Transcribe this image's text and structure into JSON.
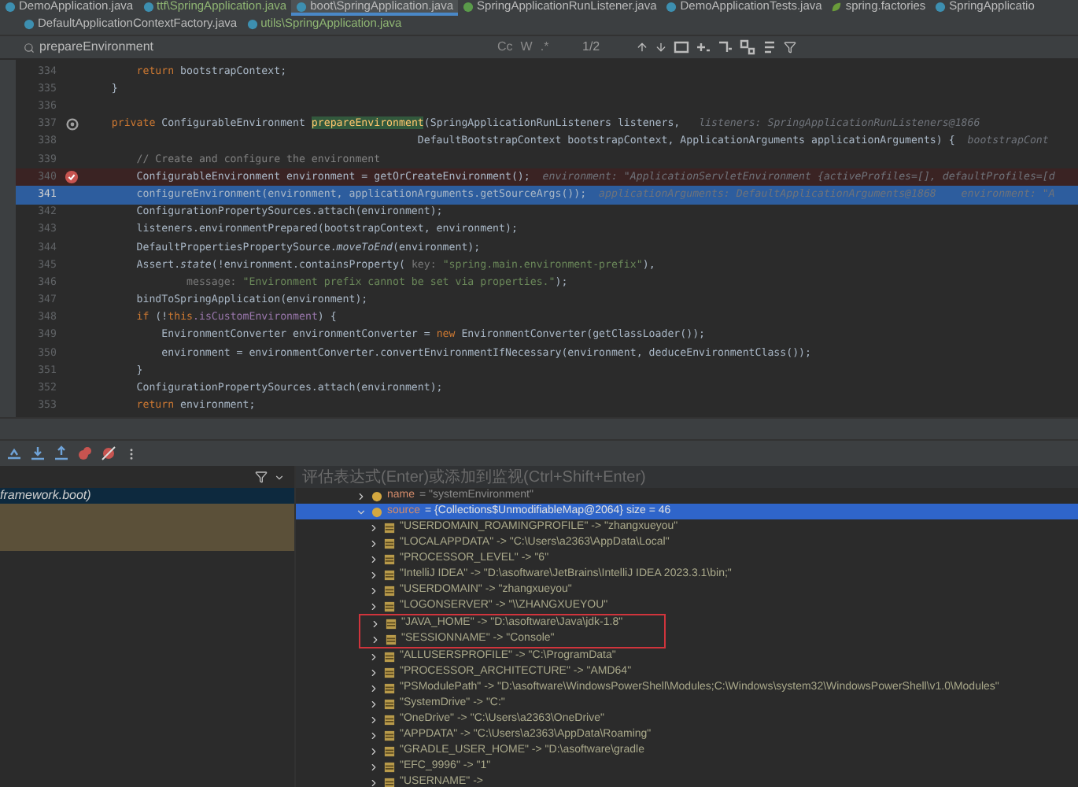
{
  "editor_tabs": [
    {
      "label": "DemoApplication.java",
      "kind": "java",
      "selected": false,
      "color": "#bbbbbb"
    },
    {
      "label": "ttf\\SpringApplication.java",
      "kind": "java",
      "selected": false,
      "color": "#8fb573"
    },
    {
      "label": "boot\\SpringApplication.java",
      "kind": "java",
      "selected": true,
      "color": "#bbbbbb"
    },
    {
      "label": "SpringApplicationRunListener.java",
      "kind": "interface",
      "selected": false,
      "color": "#bbbbbb"
    },
    {
      "label": "DemoApplicationTests.java",
      "kind": "java",
      "selected": false,
      "color": "#bbbbbb"
    },
    {
      "label": "spring.factories",
      "kind": "factories",
      "selected": false,
      "color": "#bbbbbb"
    },
    {
      "label": "SpringApplicatio",
      "kind": "java",
      "selected": false,
      "color": "#bbbbbb"
    }
  ],
  "editor_tabs_row_2": [
    {
      "label": "DefaultApplicationContextFactory.java",
      "kind": "java",
      "selected": false,
      "color": "#bbbbbb"
    },
    {
      "label": "utils\\SpringApplication.java",
      "kind": "java",
      "selected": false,
      "color": "#8fb573"
    }
  ],
  "find_bar": {
    "value": "prepareEnvironment",
    "options": [
      "Cc",
      "W",
      ".*"
    ],
    "match_count": "1/2"
  },
  "code_lines": [
    {
      "number": "334",
      "breakpoint": false,
      "override": false,
      "current": false,
      "tokens": [
        {
          "kind": "keyword",
          "text": "        return"
        },
        {
          "kind": "plain",
          "text": " bootstrapContext;"
        }
      ]
    },
    {
      "number": "335",
      "breakpoint": false,
      "override": false,
      "current": false,
      "tokens": [
        {
          "kind": "plain",
          "text": "    }"
        }
      ]
    },
    {
      "number": "336",
      "breakpoint": false,
      "override": false,
      "current": false
    },
    {
      "number": "337",
      "breakpoint": false,
      "override": true,
      "current": false,
      "tokens": [
        {
          "kind": "keyword",
          "text": "    private"
        },
        {
          "kind": "plain",
          "text": " ConfigurableEnvironment "
        },
        {
          "kind": "match",
          "text": "prepareEnvironment"
        },
        {
          "kind": "plain",
          "text": "(SpringApplicationRunListeners listeners,"
        },
        {
          "kind": "hint",
          "text": "   listeners: SpringApplicationRunListeners@1866"
        }
      ]
    },
    {
      "number": "338",
      "breakpoint": false,
      "override": false,
      "current": false,
      "tokens": [
        {
          "kind": "plain",
          "text": "                                                     DefaultBootstrapContext bootstrapContext, ApplicationArguments applicationArguments) {"
        },
        {
          "kind": "hint",
          "text": "  bootstrapCont"
        }
      ]
    },
    {
      "number": "339",
      "breakpoint": false,
      "override": false,
      "current": false,
      "tokens": [
        {
          "kind": "comment",
          "text": "        // Create and configure the environment"
        }
      ]
    },
    {
      "number": "340",
      "breakpoint": true,
      "override": false,
      "current": false,
      "tokens": [
        {
          "kind": "plain",
          "text": "        ConfigurableEnvironment environment = getOrCreateEnvironment();"
        },
        {
          "kind": "hint",
          "text": "  environment: \"ApplicationServletEnvironment {activeProfiles=[], defaultProfiles=[d"
        }
      ]
    },
    {
      "number": "341",
      "breakpoint": false,
      "override": false,
      "current": true,
      "tokens": [
        {
          "kind": "plain",
          "text": "        configureEnvironment(environment, applicationArguments.getSourceArgs());"
        },
        {
          "kind": "hint",
          "text": "  applicationArguments: DefaultApplicationArguments@1868    environment: \"A"
        }
      ]
    },
    {
      "number": "342",
      "breakpoint": false,
      "override": false,
      "current": false,
      "tokens": [
        {
          "kind": "plain",
          "text": "        ConfigurationPropertySources.attach(environment);"
        }
      ]
    },
    {
      "number": "343",
      "breakpoint": false,
      "override": false,
      "current": false,
      "tokens": [
        {
          "kind": "plain",
          "text": "        listeners.environmentPrepared(bootstrapContext, environment);"
        }
      ]
    },
    {
      "number": "344",
      "breakpoint": false,
      "override": false,
      "current": false,
      "tokens": [
        {
          "kind": "plain",
          "text": "        DefaultPropertiesPropertySource."
        },
        {
          "kind": "static",
          "text": "moveToEnd"
        },
        {
          "kind": "plain",
          "text": "(environment);"
        }
      ]
    },
    {
      "number": "345",
      "breakpoint": false,
      "override": false,
      "current": false,
      "tokens": [
        {
          "kind": "plain",
          "text": "        Assert."
        },
        {
          "kind": "static",
          "text": "state"
        },
        {
          "kind": "plain",
          "text": "(!environment.containsProperty("
        },
        {
          "kind": "label",
          "text": " key: "
        },
        {
          "kind": "string",
          "text": "\"spring.main.environment-prefix\""
        },
        {
          "kind": "plain",
          "text": "),"
        }
      ]
    },
    {
      "number": "346",
      "breakpoint": false,
      "override": false,
      "current": false,
      "tokens": [
        {
          "kind": "label",
          "text": "                message: "
        },
        {
          "kind": "string",
          "text": "\"Environment prefix cannot be set via properties.\""
        },
        {
          "kind": "plain",
          "text": ");"
        }
      ]
    },
    {
      "number": "347",
      "breakpoint": false,
      "override": false,
      "current": false,
      "tokens": [
        {
          "kind": "plain",
          "text": "        bindToSpringApplication(environment);"
        }
      ]
    },
    {
      "number": "348",
      "breakpoint": false,
      "override": false,
      "current": false,
      "tokens": [
        {
          "kind": "keyword",
          "text": "        if"
        },
        {
          "kind": "plain",
          "text": " (!"
        },
        {
          "kind": "keyword",
          "text": "this"
        },
        {
          "kind": "field",
          "text": ".isCustomEnvironment"
        },
        {
          "kind": "plain",
          "text": ") {"
        }
      ]
    },
    {
      "number": "349",
      "breakpoint": false,
      "override": false,
      "current": false,
      "tokens": [
        {
          "kind": "plain",
          "text": "            EnvironmentConverter environmentConverter = "
        },
        {
          "kind": "keyword",
          "text": "new"
        },
        {
          "kind": "plain",
          "text": " EnvironmentConverter(getClassLoader());"
        }
      ]
    },
    {
      "number": "350",
      "breakpoint": false,
      "override": false,
      "current": false,
      "tokens": [
        {
          "kind": "plain",
          "text": "            environment = environmentConverter.convertEnvironmentIfNecessary(environment, deduceEnvironmentClass());"
        }
      ]
    },
    {
      "number": "351",
      "breakpoint": false,
      "override": false,
      "current": false,
      "tokens": [
        {
          "kind": "plain",
          "text": "        }"
        }
      ]
    },
    {
      "number": "352",
      "breakpoint": false,
      "override": false,
      "current": false,
      "tokens": [
        {
          "kind": "plain",
          "text": "        ConfigurationPropertySources.attach(environment);"
        }
      ]
    },
    {
      "number": "353",
      "breakpoint": false,
      "override": false,
      "current": false,
      "tokens": [
        {
          "kind": "keyword",
          "text": "        return"
        },
        {
          "kind": "plain",
          "text": " environment;"
        }
      ]
    }
  ],
  "frames": [
    {
      "kind": "app",
      "text": "framework.boot)",
      "selected": true
    },
    {
      "kind": "library",
      "selected": false
    },
    {
      "kind": "library",
      "selected": false
    },
    {
      "kind": "library",
      "selected": false
    }
  ],
  "evaluate_field": {
    "placeholder": "评估表达式(Enter)或添加到监视(Ctrl+Shift+Enter)"
  },
  "variables": [
    {
      "name": "name",
      "value": "= \"systemEnvironment\"",
      "expanded": false,
      "selected": false
    },
    {
      "name": "source",
      "value": "= {Collections$UnmodifiableMap@2064}  size = 46",
      "expanded": true,
      "selected": true,
      "children": [
        {
          "text": "\"USERDOMAIN_ROAMINGPROFILE\" -> \"zhangxueyou\"",
          "highlighted": false
        },
        {
          "text": "\"LOCALAPPDATA\" -> \"C:\\Users\\a2363\\AppData\\Local\"",
          "highlighted": false
        },
        {
          "text": "\"PROCESSOR_LEVEL\" -> \"6\"",
          "highlighted": false
        },
        {
          "text": "\"IntelliJ IDEA\" -> \"D:\\asoftware\\JetBrains\\IntelliJ IDEA 2023.3.1\\bin;\"",
          "highlighted": false
        },
        {
          "text": "\"USERDOMAIN\" -> \"zhangxueyou\"",
          "highlighted": false
        },
        {
          "text": "\"LOGONSERVER\" -> \"\\\\ZHANGXUEYOU\"",
          "highlighted": false
        },
        {
          "text": "\"JAVA_HOME\" -> \"D:\\asoftware\\Java\\jdk-1.8\"",
          "highlighted": true
        },
        {
          "text": "\"SESSIONNAME\" -> \"Console\"",
          "highlighted": true
        },
        {
          "text": "\"ALLUSERSPROFILE\" -> \"C:\\ProgramData\"",
          "highlighted": false
        },
        {
          "text": "\"PROCESSOR_ARCHITECTURE\" -> \"AMD64\"",
          "highlighted": false
        },
        {
          "text": "\"PSModulePath\" -> \"D:\\asoftware\\WindowsPowerShell\\Modules;C:\\Windows\\system32\\WindowsPowerShell\\v1.0\\Modules\"",
          "highlighted": false
        },
        {
          "text": "\"SystemDrive\" -> \"C:\"",
          "highlighted": false
        },
        {
          "text": "\"OneDrive\" -> \"C:\\Users\\a2363\\OneDrive\"",
          "highlighted": false
        },
        {
          "text": "\"APPDATA\" -> \"C:\\Users\\a2363\\AppData\\Roaming\"",
          "highlighted": false
        },
        {
          "text": "\"GRADLE_USER_HOME\" -> \"D:\\asoftware\\gradle",
          "highlighted": false
        },
        {
          "text": "\"EFC_9996\" -> \"1\"",
          "highlighted": false
        },
        {
          "text": "\"USERNAME\" ->",
          "highlighted": false
        }
      ]
    }
  ]
}
